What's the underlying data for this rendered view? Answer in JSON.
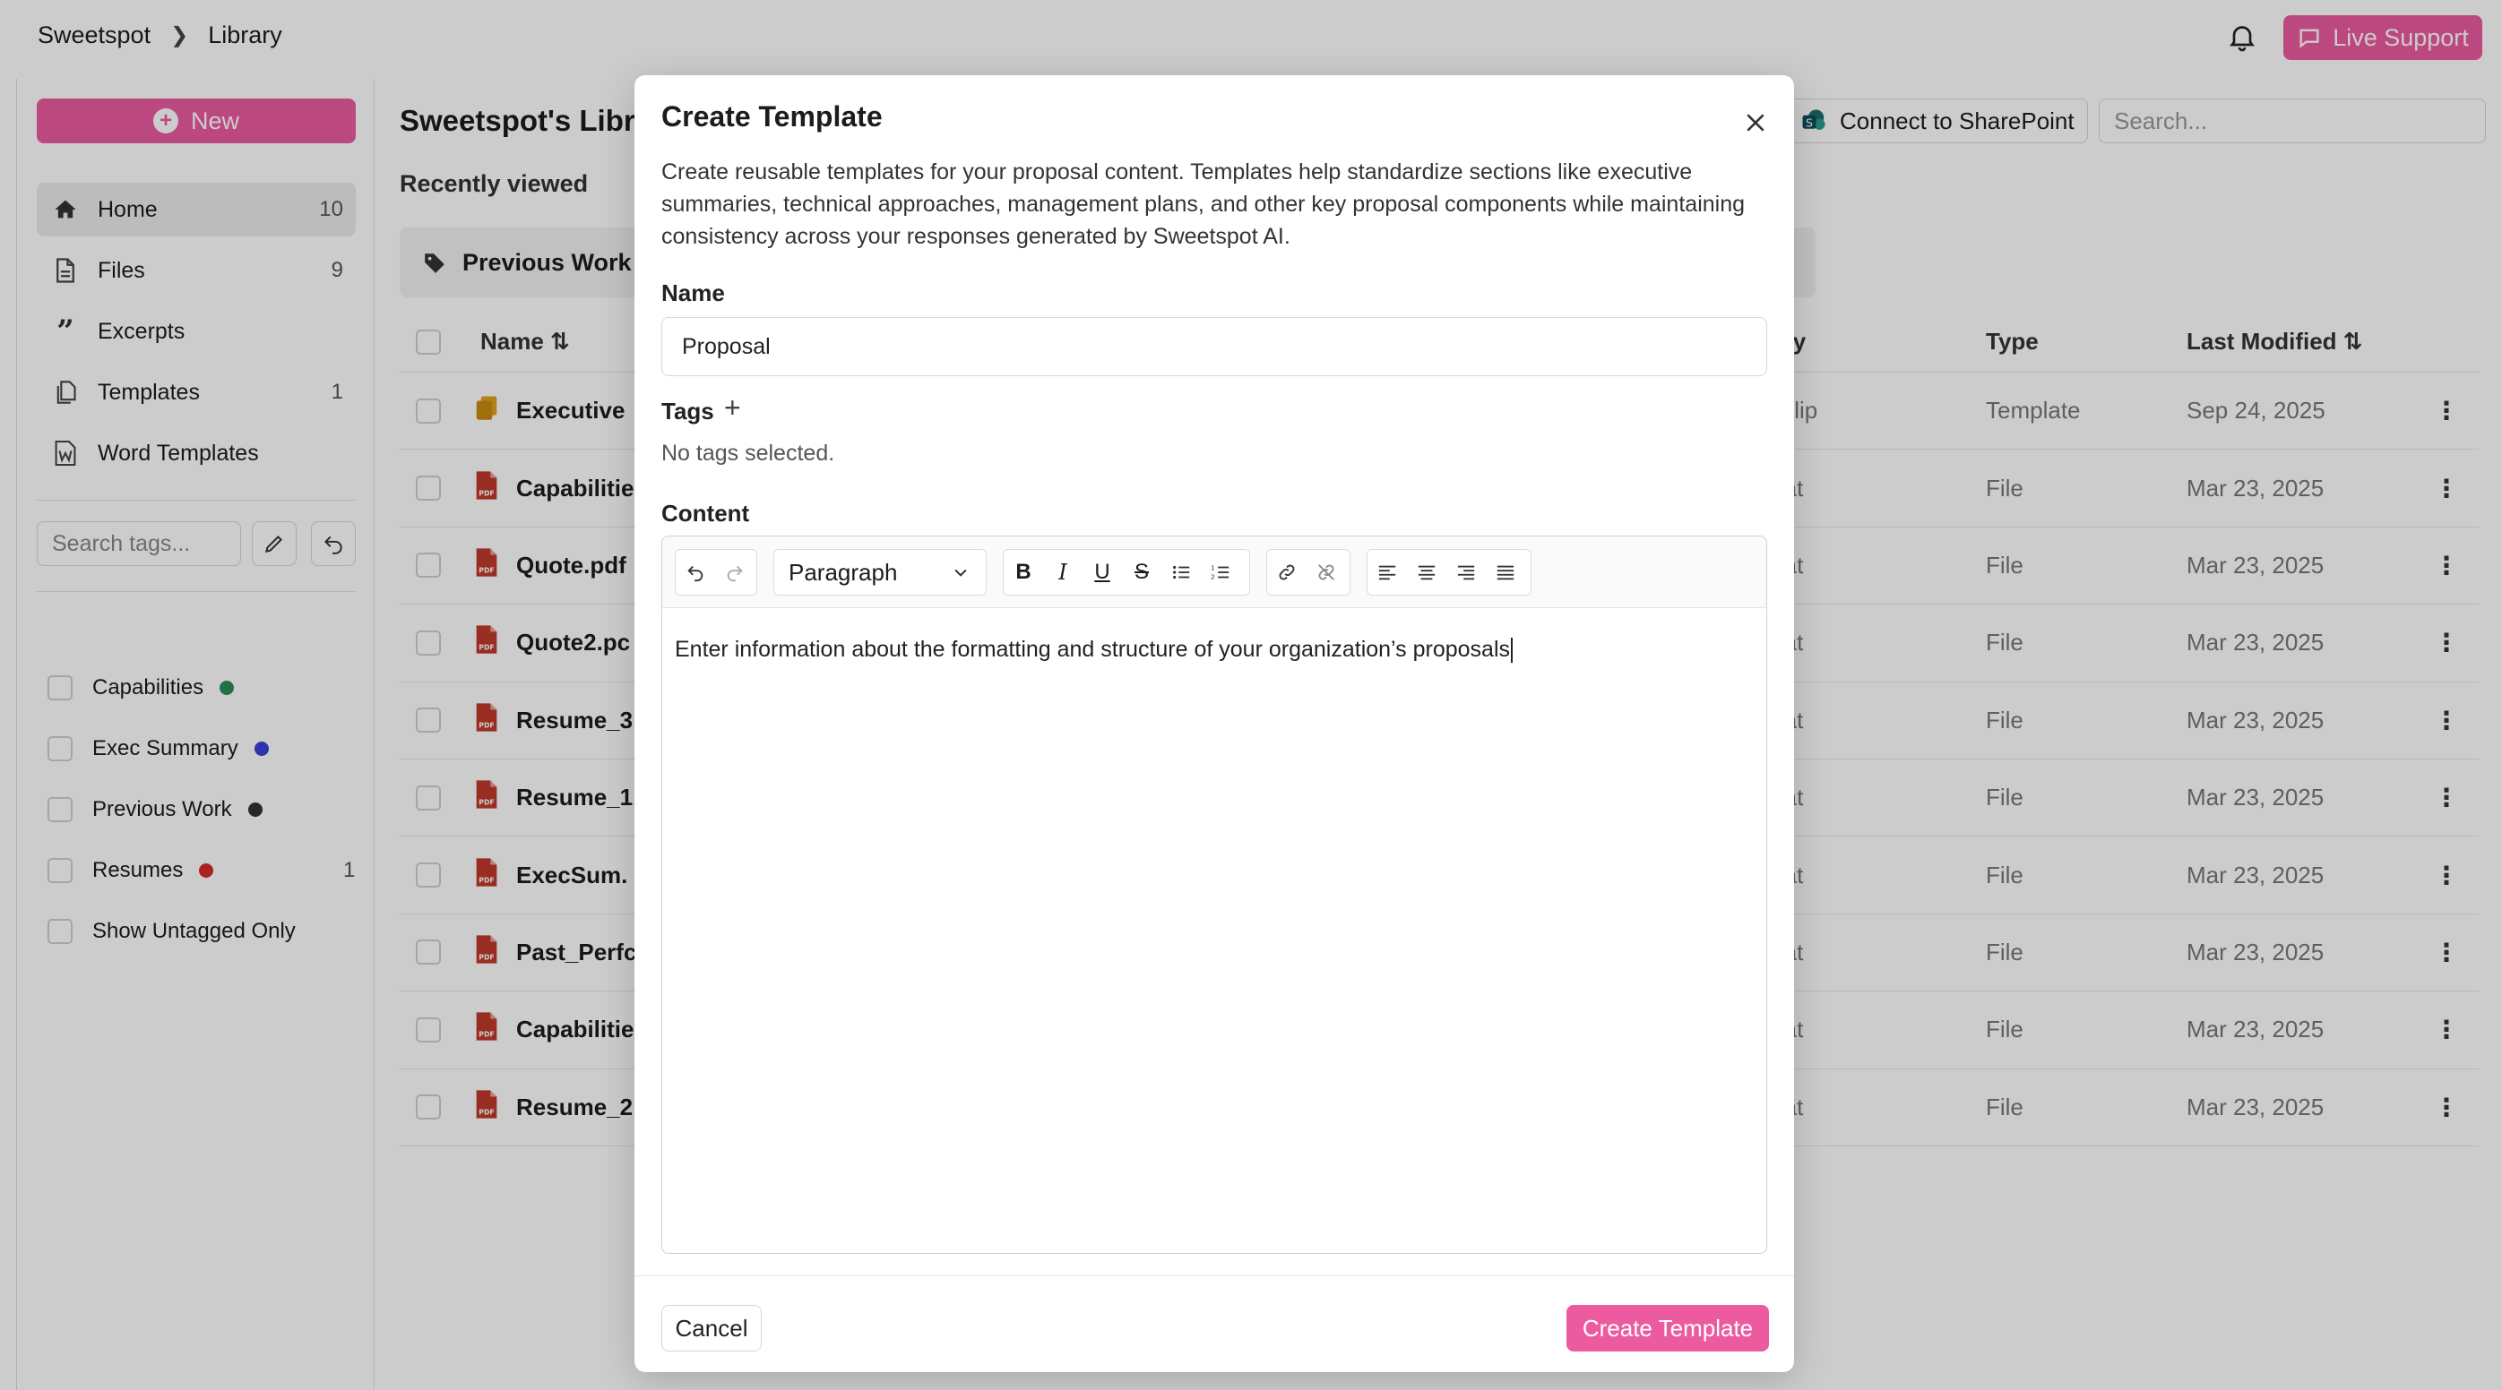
{
  "breadcrumb": {
    "root": "Sweetspot",
    "current": "Library"
  },
  "header": {
    "live_support": "Live Support"
  },
  "sidebar": {
    "new_label": "New",
    "nav": [
      {
        "label": "Home",
        "count": "10",
        "icon": "home-icon"
      },
      {
        "label": "Files",
        "count": "9",
        "icon": "file-icon"
      },
      {
        "label": "Excerpts",
        "count": "",
        "icon": "quote-icon"
      },
      {
        "label": "Templates",
        "count": "1",
        "icon": "copy-icon"
      },
      {
        "label": "Word Templates",
        "count": "",
        "icon": "word-doc-icon"
      }
    ],
    "tag_search_placeholder": "Search tags...",
    "tags": [
      {
        "label": "Capabilities",
        "color": "#2e8b57",
        "count": ""
      },
      {
        "label": "Exec Summary",
        "color": "#3b3fd6",
        "count": ""
      },
      {
        "label": "Previous Work",
        "color": "#333333",
        "count": ""
      },
      {
        "label": "Resumes",
        "color": "#d42a2a",
        "count": "1"
      },
      {
        "label": "Show Untagged Only",
        "color": "",
        "count": ""
      }
    ]
  },
  "main": {
    "title": "Sweetspot's Libra",
    "recently_viewed": "Recently viewed",
    "recent_card": "Previous Work",
    "sharepoint": "Connect to SharePoint",
    "search_placeholder": "Search...",
    "columns": {
      "name": "Name",
      "by": "By",
      "type": "Type",
      "modified": "Last Modified"
    },
    "rows": [
      {
        "name": "Executive",
        "by": "hilip",
        "type": "Template",
        "modified": "Sep 24, 2025",
        "icon": "template-icon"
      },
      {
        "name": "Capabilitie",
        "by": "rat",
        "type": "File",
        "modified": "Mar 23, 2025",
        "icon": "pdf-icon"
      },
      {
        "name": "Quote.pdf",
        "by": "rat",
        "type": "File",
        "modified": "Mar 23, 2025",
        "icon": "pdf-icon"
      },
      {
        "name": "Quote2.pc",
        "by": "rat",
        "type": "File",
        "modified": "Mar 23, 2025",
        "icon": "pdf-icon"
      },
      {
        "name": "Resume_3",
        "by": "rat",
        "type": "File",
        "modified": "Mar 23, 2025",
        "icon": "pdf-icon"
      },
      {
        "name": "Resume_1.",
        "by": "rat",
        "type": "File",
        "modified": "Mar 23, 2025",
        "icon": "pdf-icon"
      },
      {
        "name": "ExecSum.",
        "by": "rat",
        "type": "File",
        "modified": "Mar 23, 2025",
        "icon": "pdf-icon"
      },
      {
        "name": "Past_Perfc",
        "by": "rat",
        "type": "File",
        "modified": "Mar 23, 2025",
        "icon": "pdf-icon"
      },
      {
        "name": "Capabilitie",
        "by": "rat",
        "type": "File",
        "modified": "Mar 23, 2025",
        "icon": "pdf-icon"
      },
      {
        "name": "Resume_2",
        "by": "rat",
        "type": "File",
        "modified": "Mar 23, 2025",
        "icon": "pdf-icon"
      }
    ]
  },
  "modal": {
    "title": "Create Template",
    "description": "Create reusable templates for your proposal content. Templates help standardize sections like executive summaries, technical approaches, management plans, and other key proposal components while maintaining consistency across your responses generated by Sweetspot AI.",
    "name_label": "Name",
    "name_value": "Proposal",
    "tags_label": "Tags",
    "no_tags": "No tags selected.",
    "content_label": "Content",
    "paragraph_select": "Paragraph",
    "content_text": "Enter information about the formatting and structure of your organization’s proposals",
    "cancel": "Cancel",
    "create": "Create Template"
  },
  "colors": {
    "accent": "#ec5aa0",
    "pdf": "#c0392b",
    "template": "#e0a020"
  }
}
